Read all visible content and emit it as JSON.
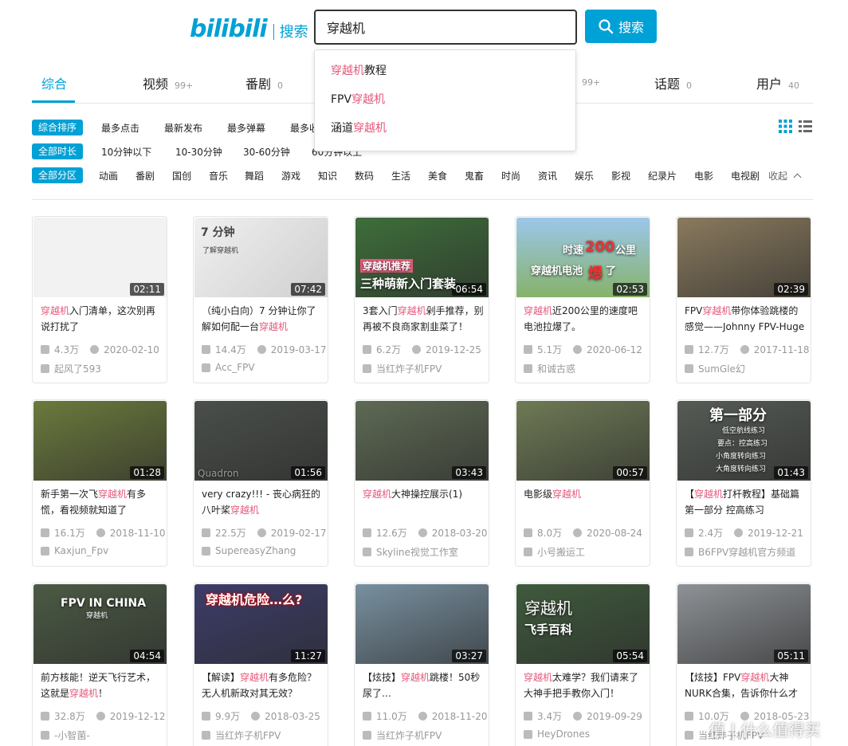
{
  "header": {
    "logo_text": "bilibili",
    "logo_sub": "搜索",
    "search_value": "穿越机",
    "search_button": "搜索"
  },
  "suggestions": [
    {
      "hl": "穿越机",
      "rest": "教程",
      "prefix": ""
    },
    {
      "prefix": "FPV",
      "hl": "穿越机",
      "rest": ""
    },
    {
      "prefix": "涵道",
      "hl": "穿越机",
      "rest": ""
    }
  ],
  "tabs": [
    {
      "label": "综合",
      "count": ""
    },
    {
      "label": "视频",
      "count": "99+"
    },
    {
      "label": "番剧",
      "count": "0"
    },
    {
      "label": "",
      "count": "99+"
    },
    {
      "label": "话题",
      "count": "0"
    },
    {
      "label": "用户",
      "count": "40"
    }
  ],
  "filters": {
    "sort_pill": "综合排序",
    "sort": [
      "最多点击",
      "最新发布",
      "最多弹幕",
      "最多收"
    ],
    "dur_pill": "全部时长",
    "durations": [
      "10分钟以下",
      "10-30分钟",
      "30-60分钟",
      "60分钟以上"
    ],
    "zone_pill": "全部分区",
    "zones": [
      "动画",
      "番剧",
      "国创",
      "音乐",
      "舞蹈",
      "游戏",
      "知识",
      "数码",
      "生活",
      "美食",
      "鬼畜",
      "时尚",
      "资讯",
      "娱乐",
      "影视",
      "纪录片",
      "电影",
      "电视剧"
    ],
    "collapse": "收起"
  },
  "videos": [
    {
      "t1": "",
      "hl": "穿越机",
      "t2": "入门清单，这次别再说打扰了",
      "duration": "02:11",
      "views": "4.3万",
      "date": "2020-02-10",
      "uploader": "起风了593",
      "bg": "#e9e9e9"
    },
    {
      "t1": "（纯小白向）7 分钟让你了解如何配一台",
      "hl": "穿越机",
      "t2": "",
      "duration": "07:42",
      "views": "14.4万",
      "date": "2019-03-17",
      "uploader": "Acc_FPV",
      "bg": "#d8d8d8"
    },
    {
      "t1": "3套入门",
      "hl": "穿越机",
      "t2": "剁手推荐，别再被不良商家割韭菜了！",
      "duration": "06:54",
      "views": "6.2万",
      "date": "2019-12-25",
      "uploader": "当红炸子机FPV",
      "bg": "#3e6e3a"
    },
    {
      "t1": "",
      "hl": "穿越机",
      "t2": "近200公里的速度吧电池拉爆了。",
      "duration": "02:53",
      "views": "5.1万",
      "date": "2020-06-12",
      "uploader": "和诚古惑",
      "bg": "#7fb1d8"
    },
    {
      "t1": "FPV",
      "hl": "穿越机",
      "t2": "带你体验跳楼的感觉——Johnny FPV-Huge",
      "duration": "02:39",
      "views": "12.7万",
      "date": "2017-11-18",
      "uploader": "SumGle幻",
      "bg": "#8a7a5e"
    },
    {
      "t1": "新手第一次飞",
      "hl": "穿越机",
      "t2": "有多慌，看视频就知道了",
      "duration": "01:28",
      "views": "16.1万",
      "date": "2018-11-10",
      "uploader": "Kaxjun_Fpv",
      "bg": "#6b7a3c"
    },
    {
      "t1": "very crazy!!! - 丧心病狂的八叶桨",
      "hl": "穿越机",
      "t2": "",
      "duration": "01:56",
      "views": "22.5万",
      "date": "2019-02-17",
      "uploader": "SupereasyZhang",
      "bg": "#4a4f4a"
    },
    {
      "t1": "",
      "hl": "穿越机",
      "t2": "大神操控展示(1)",
      "duration": "03:43",
      "views": "12.6万",
      "date": "2018-03-20",
      "uploader": "Skyline视觉工作室",
      "bg": "#5e6a54"
    },
    {
      "t1": "电影级",
      "hl": "穿越机",
      "t2": "",
      "duration": "00:57",
      "views": "8.0万",
      "date": "2020-08-24",
      "uploader": "小号搬运工",
      "bg": "#6e7a55"
    },
    {
      "t1": "【",
      "hl": "穿越机",
      "t2": "打杆教程】基础篇第一部分 控高练习",
      "duration": "01:43",
      "views": "2.4万",
      "date": "2019-12-21",
      "uploader": "B6FPV穿越机官方频道",
      "bg": "#555b55"
    },
    {
      "t1": "前方核能！逆天飞行艺术，这就是",
      "hl": "穿越机",
      "t2": "！",
      "duration": "04:54",
      "views": "32.8万",
      "date": "2019-12-12",
      "uploader": "-小智菌-",
      "bg": "#4b5a44"
    },
    {
      "t1": "【解读】",
      "hl": "穿越机",
      "t2": "有多危险？无人机新政对其无效？",
      "duration": "11:27",
      "views": "9.9万",
      "date": "2018-03-25",
      "uploader": "当红炸子机FPV",
      "bg": "#3c3c6a"
    },
    {
      "t1": "【炫技】",
      "hl": "穿越机",
      "t2": "跳楼！50秒尿了…",
      "duration": "03:27",
      "views": "11.0万",
      "date": "2018-11-20",
      "uploader": "当红炸子机FPV",
      "bg": "#7890a0"
    },
    {
      "t1": "",
      "hl": "穿越机",
      "t2": "太难学？我们请来了大神手把手教你入门！",
      "duration": "05:54",
      "views": "3.4万",
      "date": "2019-09-29",
      "uploader": "HeyDrones",
      "bg": "#3f5a3c"
    },
    {
      "t1": "【炫技】FPV",
      "hl": "穿越机",
      "t2": "大神NURK合集，告诉你什么才",
      "duration": "05:11",
      "views": "10.0万",
      "date": "2018-05-23",
      "uploader": "当红炸子机FPV",
      "bg": "#8e9296"
    }
  ],
  "thumb_texts": {
    "v1": "7 分钟",
    "v1b": "了解穿越机",
    "v2a": "穿越机推荐",
    "v2b": "三种萌新入门套装",
    "v3a": "时速",
    "v3b": "200",
    "v3c": "公里",
    "v3d": "穿越机电池",
    "v3e": "爆",
    "v3f": "了",
    "v9a": "第一部分",
    "v9b": "低空航线练习",
    "v9c": "要点：控高练习",
    "v9d": "小角度转向练习",
    "v9e": "大角度转向练习",
    "v10": "FPV IN CHINA",
    "v10b": "穿越机",
    "v11": "穿越机危险…么?",
    "v13a": "穿越机",
    "v13b": "飞手百科",
    "v6": "Quadron"
  },
  "watermark": "值 | 什么值得买"
}
